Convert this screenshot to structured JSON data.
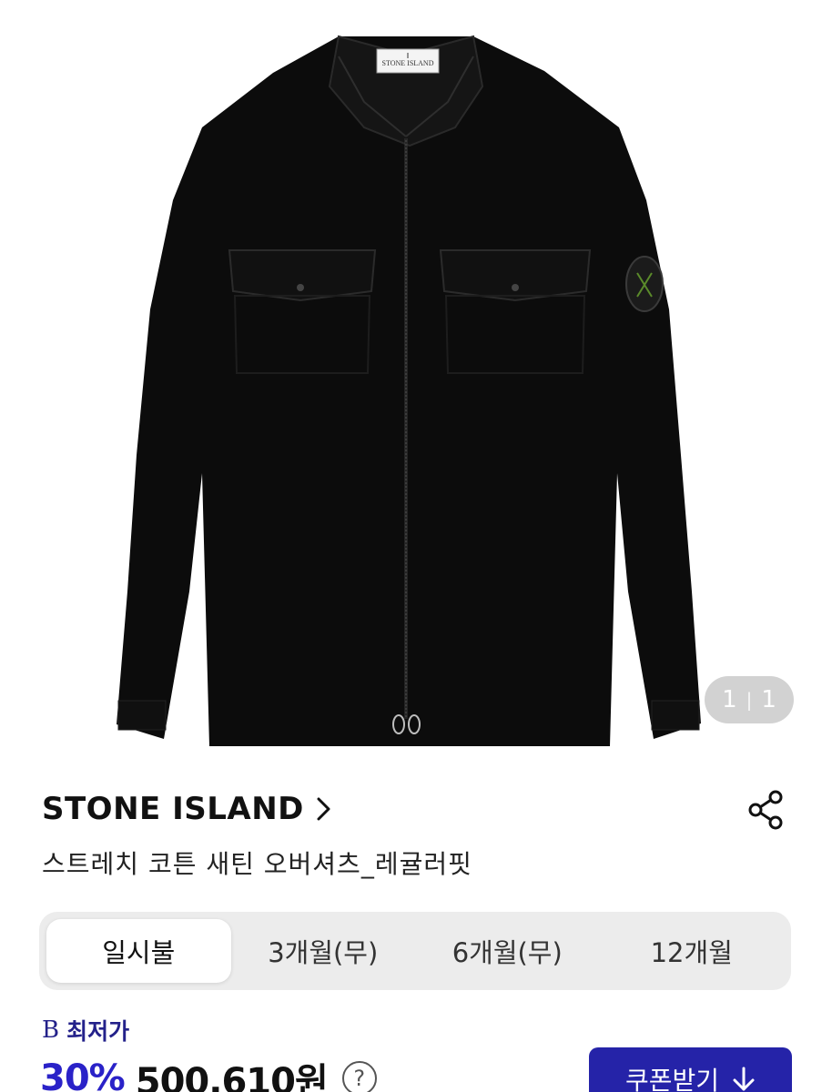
{
  "product": {
    "label_text": "STONE ISLAND",
    "image_index": "1",
    "image_separator": "|",
    "image_total": "1"
  },
  "brand": {
    "name": "STONE ISLAND",
    "chevron": ">"
  },
  "title": "스트레치 코튼 새틴 오버셔츠_레귤러핏",
  "installment_tabs": [
    {
      "label": "일시불",
      "active": true
    },
    {
      "label": "3개월(무)",
      "active": false
    },
    {
      "label": "6개월(무)",
      "active": false
    },
    {
      "label": "12개월",
      "active": false
    }
  ],
  "lowest": {
    "logo": "B",
    "label": "최저가"
  },
  "price": {
    "discount": "30%",
    "amount": "500,610원",
    "help": "?"
  },
  "coupon": {
    "label": "쿠폰받기",
    "icon": "download-arrow-icon"
  },
  "colors": {
    "brand_navy": "#2523a8",
    "discount_blue": "#2a22c8",
    "tab_bg": "#ececec"
  }
}
